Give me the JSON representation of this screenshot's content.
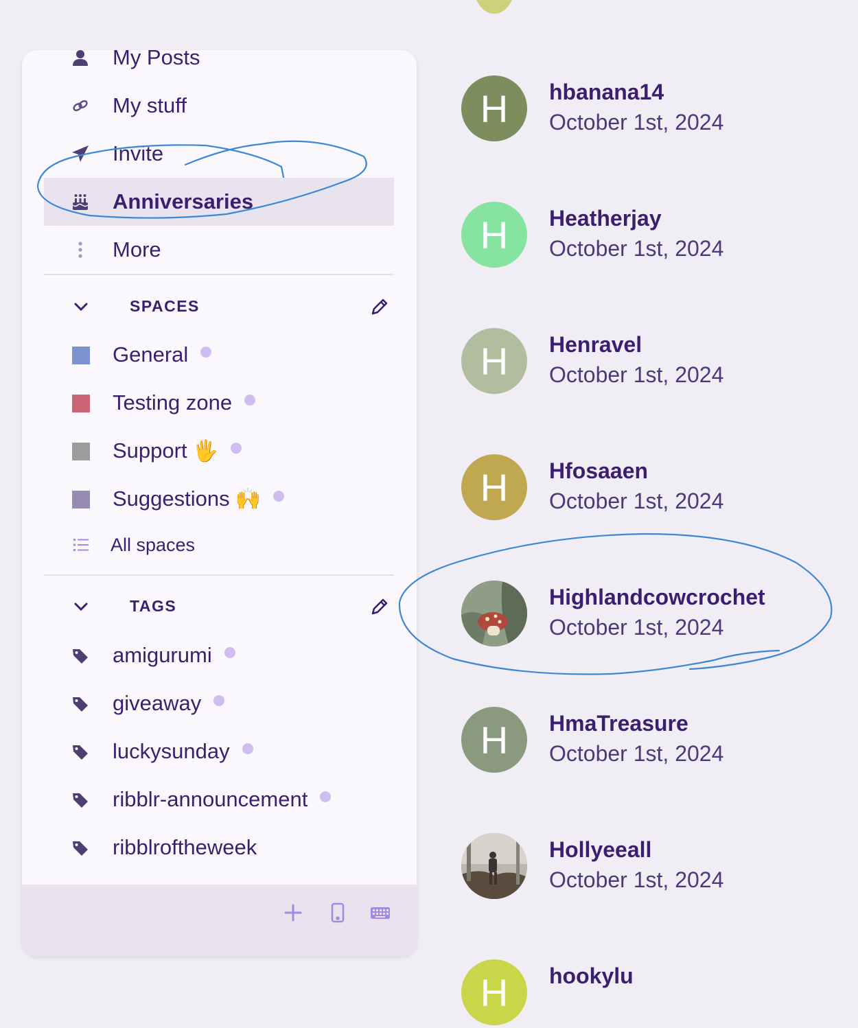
{
  "nav": {
    "items": [
      {
        "label": "My Posts",
        "icon": "person-icon"
      },
      {
        "label": "My stuff",
        "icon": "link-icon"
      },
      {
        "label": "Invite",
        "icon": "send-icon"
      },
      {
        "label": "Anniversaries",
        "icon": "cake-icon",
        "active": true
      },
      {
        "label": "More",
        "icon": "more-vertical-icon"
      }
    ]
  },
  "spaces": {
    "title": "SPACES",
    "items": [
      {
        "label": "General",
        "color": "#7b93d1",
        "emoji": ""
      },
      {
        "label": "Testing zone",
        "color": "#cc6478",
        "emoji": ""
      },
      {
        "label": "Support",
        "color": "#9c9c9c",
        "emoji": "🖐️"
      },
      {
        "label": "Suggestions",
        "color": "#958bb3",
        "emoji": "🙌"
      }
    ],
    "all_spaces": "All spaces"
  },
  "tags": {
    "title": "TAGS",
    "items": [
      {
        "label": "amigurumi"
      },
      {
        "label": "giveaway"
      },
      {
        "label": "luckysunday"
      },
      {
        "label": "ribblr-announcement"
      },
      {
        "label": "ribblroftheweek"
      }
    ]
  },
  "footer": {
    "icons": [
      "plus-icon",
      "mobile-icon",
      "keyboard-icon"
    ]
  },
  "members": [
    {
      "initial": "H",
      "name": "hbanana14",
      "date": "October 1st, 2024",
      "color": "#7d8d5e"
    },
    {
      "initial": "H",
      "name": "Heatherjay",
      "date": "October 1st, 2024",
      "color": "#86e3a0"
    },
    {
      "initial": "H",
      "name": "Henravel",
      "date": "October 1st, 2024",
      "color": "#b2bd9f"
    },
    {
      "initial": "H",
      "name": "Hfosaaen",
      "date": "October 1st, 2024",
      "color": "#c0a851"
    },
    {
      "initial": "",
      "name": "Highlandcowcrochet",
      "date": "October 1st, 2024",
      "color": "#7f8f78"
    },
    {
      "initial": "H",
      "name": "HmaTreasure",
      "date": "October 1st, 2024",
      "color": "#8a9a7e"
    },
    {
      "initial": "",
      "name": "Hollyeeall",
      "date": "October 1st, 2024",
      "color": "#6e6e66"
    },
    {
      "initial": "H",
      "name": "hookylu",
      "date": "",
      "color": "#c9d64a"
    }
  ]
}
